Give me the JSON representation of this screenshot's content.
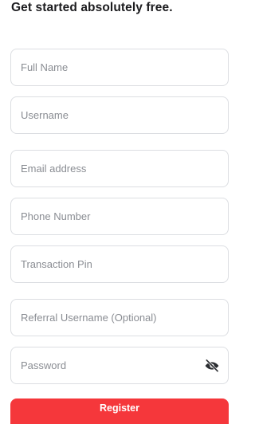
{
  "header": {
    "title": "Get started absolutely free."
  },
  "form": {
    "full_name": {
      "placeholder": "Full Name",
      "value": ""
    },
    "username": {
      "placeholder": "Username",
      "value": ""
    },
    "email": {
      "placeholder": "Email address",
      "value": ""
    },
    "phone": {
      "placeholder": "Phone Number",
      "value": ""
    },
    "transaction_pin": {
      "placeholder": "Transaction Pin",
      "value": ""
    },
    "referral_username": {
      "placeholder": "Referral Username (Optional)",
      "value": ""
    },
    "password": {
      "placeholder": "Password",
      "value": "",
      "toggle_icon": "eye-off-icon"
    },
    "register_label": "Register"
  },
  "colors": {
    "accent": "#f5373b",
    "border": "#dcdee2",
    "placeholder": "#8a8d93",
    "heading": "#1c1c1f"
  }
}
